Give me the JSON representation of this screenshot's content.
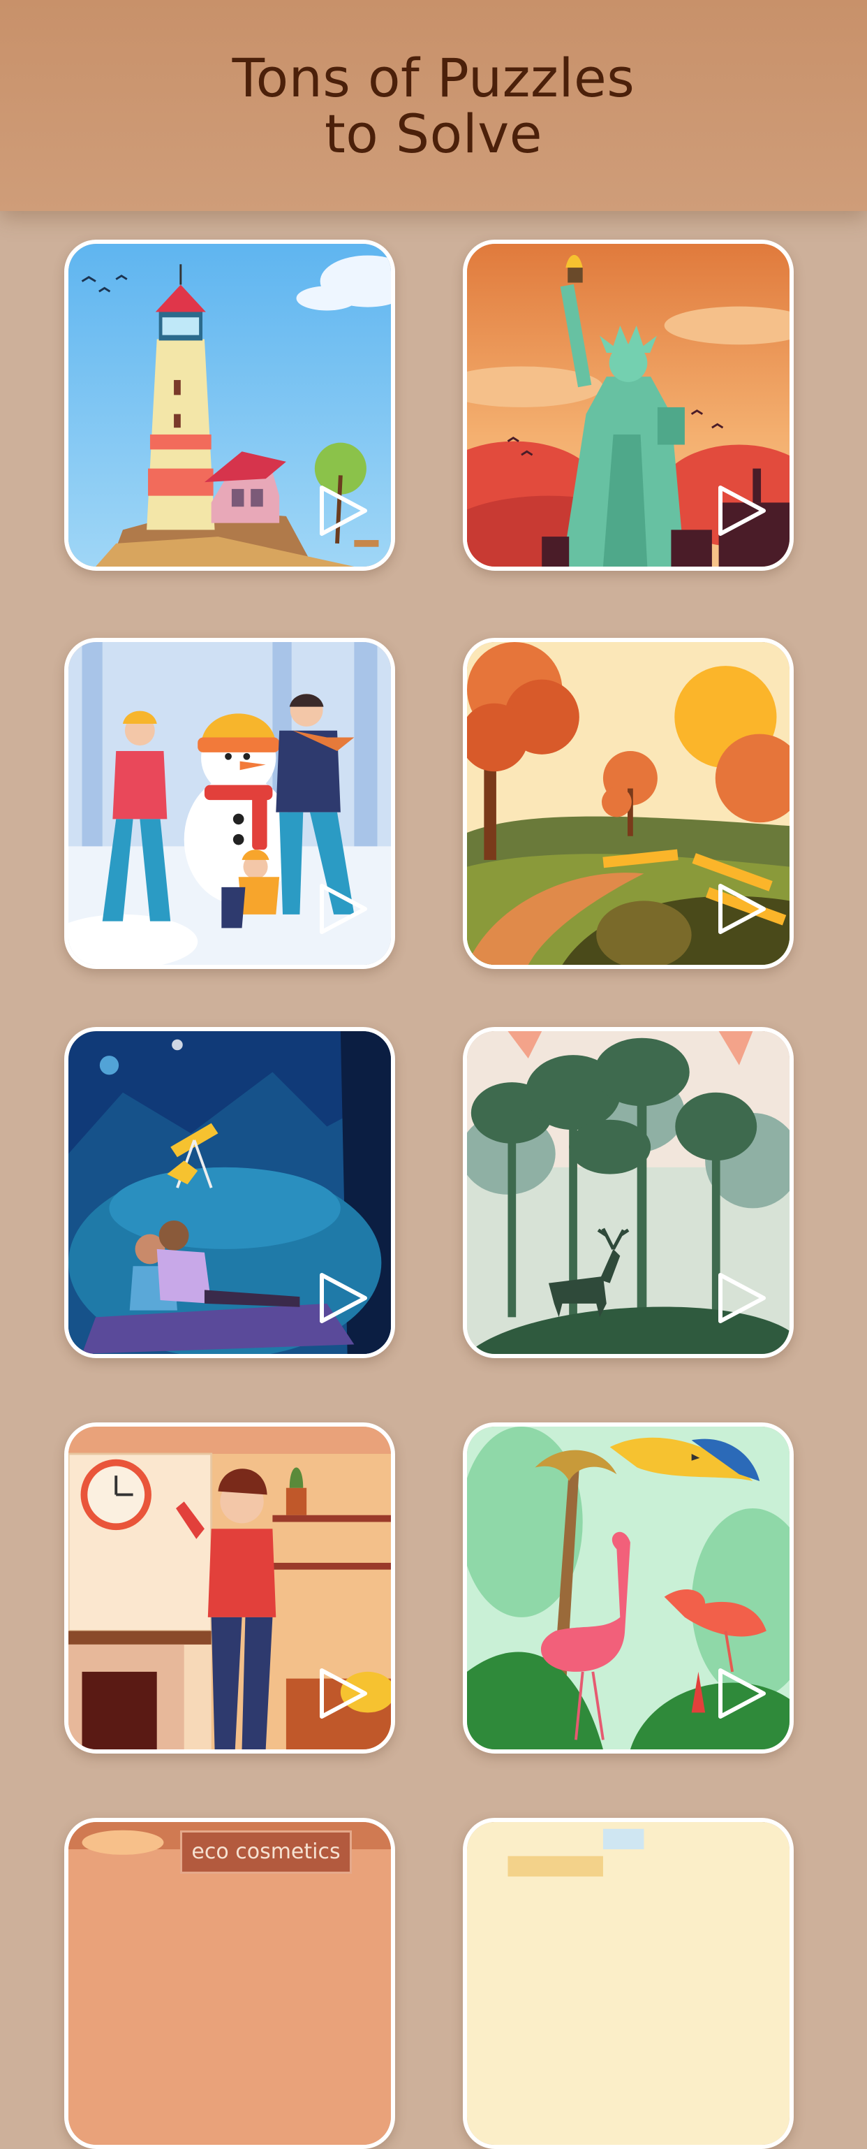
{
  "header": {
    "title": "Tons of Puzzles\nto Solve"
  },
  "colors": {
    "background": "#cdb09a",
    "header_bg": "#c8916a",
    "title_text": "#4b200a",
    "card_border": "#ffffff"
  },
  "puzzles": [
    {
      "name": "lighthouse",
      "play_icon": "play-icon"
    },
    {
      "name": "statue-of-liberty",
      "play_icon": "play-icon"
    },
    {
      "name": "snowman-family",
      "play_icon": "play-icon"
    },
    {
      "name": "autumn-field",
      "play_icon": "play-icon"
    },
    {
      "name": "stargazing-night",
      "play_icon": "play-icon"
    },
    {
      "name": "forest-deer",
      "play_icon": "play-icon"
    },
    {
      "name": "woman-at-home",
      "play_icon": "play-icon"
    },
    {
      "name": "tropical-birds",
      "play_icon": "play-icon"
    },
    {
      "name": "eco-cosmetics-shop",
      "sign_text": "eco cosmetics"
    },
    {
      "name": "cream-interior"
    }
  ]
}
